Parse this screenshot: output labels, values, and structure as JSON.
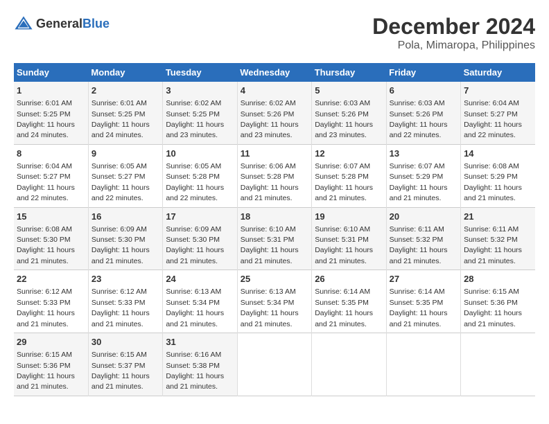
{
  "header": {
    "logo_general": "General",
    "logo_blue": "Blue",
    "month_year": "December 2024",
    "location": "Pola, Mimaropa, Philippines"
  },
  "weekdays": [
    "Sunday",
    "Monday",
    "Tuesday",
    "Wednesday",
    "Thursday",
    "Friday",
    "Saturday"
  ],
  "weeks": [
    [
      {
        "day": "1",
        "sunrise": "6:01 AM",
        "sunset": "5:25 PM",
        "daylight": "11 hours and 24 minutes."
      },
      {
        "day": "2",
        "sunrise": "6:01 AM",
        "sunset": "5:25 PM",
        "daylight": "11 hours and 24 minutes."
      },
      {
        "day": "3",
        "sunrise": "6:02 AM",
        "sunset": "5:25 PM",
        "daylight": "11 hours and 23 minutes."
      },
      {
        "day": "4",
        "sunrise": "6:02 AM",
        "sunset": "5:26 PM",
        "daylight": "11 hours and 23 minutes."
      },
      {
        "day": "5",
        "sunrise": "6:03 AM",
        "sunset": "5:26 PM",
        "daylight": "11 hours and 23 minutes."
      },
      {
        "day": "6",
        "sunrise": "6:03 AM",
        "sunset": "5:26 PM",
        "daylight": "11 hours and 22 minutes."
      },
      {
        "day": "7",
        "sunrise": "6:04 AM",
        "sunset": "5:27 PM",
        "daylight": "11 hours and 22 minutes."
      }
    ],
    [
      {
        "day": "8",
        "sunrise": "6:04 AM",
        "sunset": "5:27 PM",
        "daylight": "11 hours and 22 minutes."
      },
      {
        "day": "9",
        "sunrise": "6:05 AM",
        "sunset": "5:27 PM",
        "daylight": "11 hours and 22 minutes."
      },
      {
        "day": "10",
        "sunrise": "6:05 AM",
        "sunset": "5:28 PM",
        "daylight": "11 hours and 22 minutes."
      },
      {
        "day": "11",
        "sunrise": "6:06 AM",
        "sunset": "5:28 PM",
        "daylight": "11 hours and 21 minutes."
      },
      {
        "day": "12",
        "sunrise": "6:07 AM",
        "sunset": "5:28 PM",
        "daylight": "11 hours and 21 minutes."
      },
      {
        "day": "13",
        "sunrise": "6:07 AM",
        "sunset": "5:29 PM",
        "daylight": "11 hours and 21 minutes."
      },
      {
        "day": "14",
        "sunrise": "6:08 AM",
        "sunset": "5:29 PM",
        "daylight": "11 hours and 21 minutes."
      }
    ],
    [
      {
        "day": "15",
        "sunrise": "6:08 AM",
        "sunset": "5:30 PM",
        "daylight": "11 hours and 21 minutes."
      },
      {
        "day": "16",
        "sunrise": "6:09 AM",
        "sunset": "5:30 PM",
        "daylight": "11 hours and 21 minutes."
      },
      {
        "day": "17",
        "sunrise": "6:09 AM",
        "sunset": "5:30 PM",
        "daylight": "11 hours and 21 minutes."
      },
      {
        "day": "18",
        "sunrise": "6:10 AM",
        "sunset": "5:31 PM",
        "daylight": "11 hours and 21 minutes."
      },
      {
        "day": "19",
        "sunrise": "6:10 AM",
        "sunset": "5:31 PM",
        "daylight": "11 hours and 21 minutes."
      },
      {
        "day": "20",
        "sunrise": "6:11 AM",
        "sunset": "5:32 PM",
        "daylight": "11 hours and 21 minutes."
      },
      {
        "day": "21",
        "sunrise": "6:11 AM",
        "sunset": "5:32 PM",
        "daylight": "11 hours and 21 minutes."
      }
    ],
    [
      {
        "day": "22",
        "sunrise": "6:12 AM",
        "sunset": "5:33 PM",
        "daylight": "11 hours and 21 minutes."
      },
      {
        "day": "23",
        "sunrise": "6:12 AM",
        "sunset": "5:33 PM",
        "daylight": "11 hours and 21 minutes."
      },
      {
        "day": "24",
        "sunrise": "6:13 AM",
        "sunset": "5:34 PM",
        "daylight": "11 hours and 21 minutes."
      },
      {
        "day": "25",
        "sunrise": "6:13 AM",
        "sunset": "5:34 PM",
        "daylight": "11 hours and 21 minutes."
      },
      {
        "day": "26",
        "sunrise": "6:14 AM",
        "sunset": "5:35 PM",
        "daylight": "11 hours and 21 minutes."
      },
      {
        "day": "27",
        "sunrise": "6:14 AM",
        "sunset": "5:35 PM",
        "daylight": "11 hours and 21 minutes."
      },
      {
        "day": "28",
        "sunrise": "6:15 AM",
        "sunset": "5:36 PM",
        "daylight": "11 hours and 21 minutes."
      }
    ],
    [
      {
        "day": "29",
        "sunrise": "6:15 AM",
        "sunset": "5:36 PM",
        "daylight": "11 hours and 21 minutes."
      },
      {
        "day": "30",
        "sunrise": "6:15 AM",
        "sunset": "5:37 PM",
        "daylight": "11 hours and 21 minutes."
      },
      {
        "day": "31",
        "sunrise": "6:16 AM",
        "sunset": "5:38 PM",
        "daylight": "11 hours and 21 minutes."
      },
      null,
      null,
      null,
      null
    ]
  ],
  "labels": {
    "sunrise": "Sunrise:",
    "sunset": "Sunset:",
    "daylight": "Daylight:"
  }
}
